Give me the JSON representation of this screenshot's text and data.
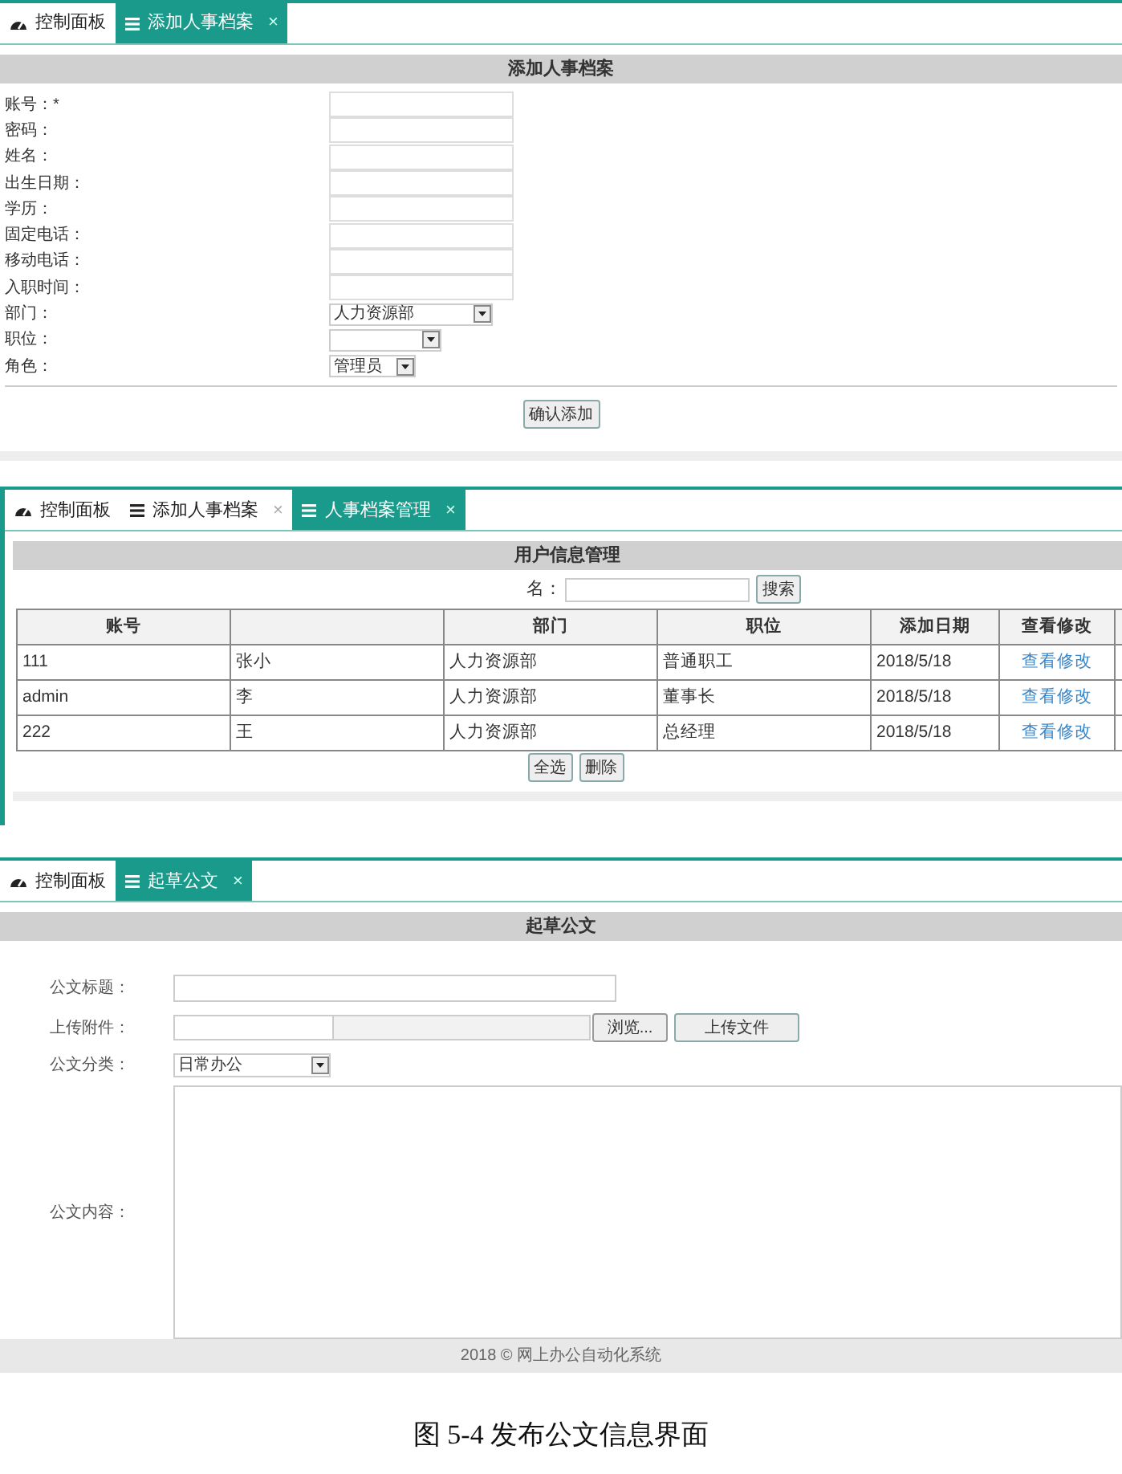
{
  "panels": [
    {
      "kind": "form",
      "tabs": [
        {
          "label": "控制面板",
          "kind": "dashboard",
          "selected": false
        },
        {
          "label": "添加人事档案",
          "kind": "page",
          "close": "×",
          "selected": true
        }
      ],
      "heading": "添加人事档案",
      "fields": [
        {
          "label": "账号：*",
          "kind": "text"
        },
        {
          "label": "密码：",
          "kind": "text"
        },
        {
          "label": "姓名：",
          "kind": "text"
        },
        {
          "label": "出生日期：",
          "kind": "text"
        },
        {
          "label": "学历：",
          "kind": "text"
        },
        {
          "label": "固定电话：",
          "kind": "text"
        },
        {
          "label": "移动电话：",
          "kind": "text"
        },
        {
          "label": "入职时间：",
          "kind": "text"
        },
        {
          "label": "部门：",
          "kind": "select",
          "value": "人力资源部"
        },
        {
          "label": "职位：",
          "kind": "select"
        },
        {
          "label": "角色：",
          "kind": "select",
          "value": "管理员"
        }
      ],
      "buttons": [
        "确认添加"
      ]
    },
    {
      "kind": "table",
      "tabs": [
        {
          "label": "控制面板",
          "kind": "dashboard",
          "selected": false
        },
        {
          "label": "添加人事档案",
          "kind": "page",
          "close": "×",
          "selected": false
        },
        {
          "label": "人事档案管理",
          "kind": "page",
          "close": "×",
          "selected": true
        }
      ],
      "heading": "用户信息管理",
      "search": {
        "label": "名：",
        "button": "搜索"
      },
      "columns": [
        "账号",
        null,
        "部门",
        "职位",
        "添加日期",
        "查看修改"
      ],
      "rows": [
        {
          "cells": [
            "111",
            "张小",
            "人力资源部",
            "普通职工",
            "2018/5/18"
          ],
          "action": "查看修改"
        },
        {
          "cells": [
            "admin",
            "李",
            "人力资源部",
            "董事长",
            "2018/5/18"
          ],
          "action": "查看修改"
        },
        {
          "cells": [
            "222",
            "王",
            "人力资源部",
            "总经理",
            "2018/5/18"
          ],
          "action": "查看修改"
        }
      ],
      "buttons": [
        "全选",
        "删除"
      ]
    },
    {
      "kind": "draft",
      "tabs": [
        {
          "label": "控制面板",
          "kind": "dashboard",
          "selected": false
        },
        {
          "label": "起草公文",
          "kind": "page",
          "close": "×",
          "selected": true
        }
      ],
      "heading": "起草公文",
      "fields": [
        {
          "label": "公文标题：",
          "kind": "text"
        },
        {
          "label": "上传附件：",
          "kind": "file",
          "browse": "浏览...",
          "upload": "上传文件"
        },
        {
          "label": "公文分类：",
          "kind": "select",
          "value": "日常办公"
        },
        {
          "label": "公文内容：",
          "kind": "textarea"
        }
      ],
      "footer": "2018 © 网上办公自动化系统"
    }
  ],
  "caption": "图 5-4 发布公文信息界面"
}
